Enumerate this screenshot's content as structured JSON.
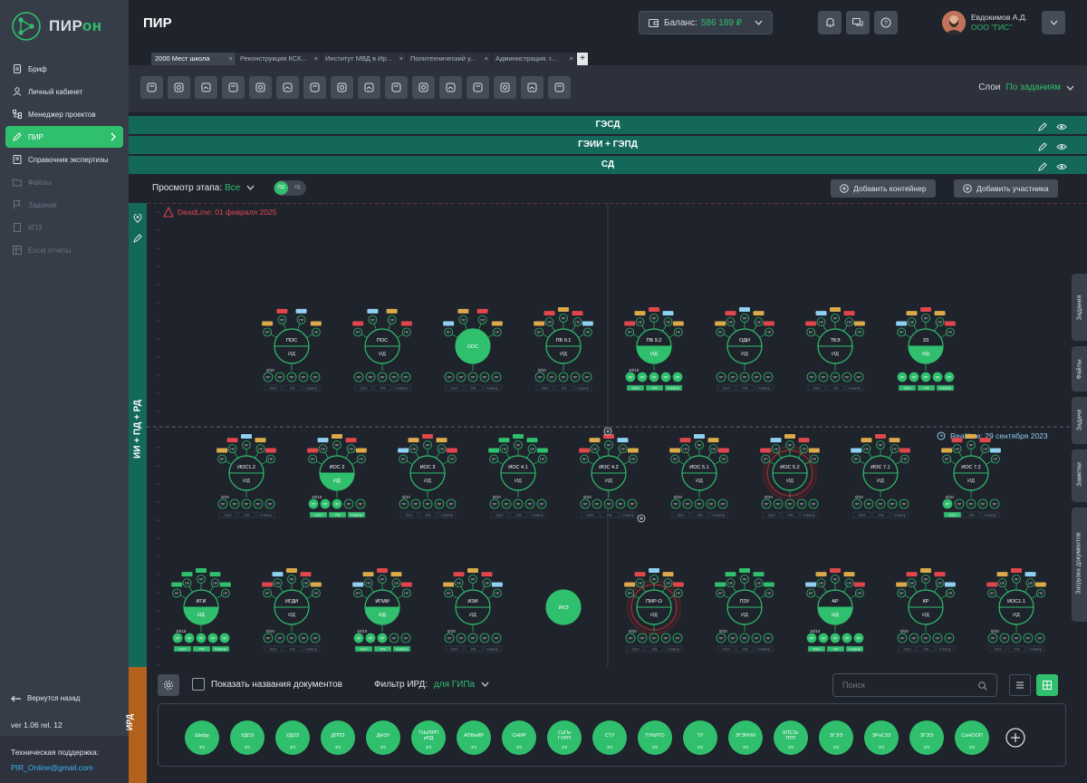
{
  "brand": {
    "name_prefix": "ПИР",
    "name_suffix": "он"
  },
  "sidebar": {
    "items": [
      {
        "label": "Бриф",
        "state": "normal"
      },
      {
        "label": "Личный кабинет",
        "state": "normal"
      },
      {
        "label": "Менеджер проектов",
        "state": "normal"
      },
      {
        "label": "ПИР",
        "state": "active"
      },
      {
        "label": "Справочник экспертизы",
        "state": "normal"
      },
      {
        "label": "Файлы",
        "state": "disabled"
      },
      {
        "label": "Задания",
        "state": "disabled"
      },
      {
        "label": "КПЗ",
        "state": "disabled"
      },
      {
        "label": "Excel отчеты",
        "state": "disabled"
      }
    ],
    "back_label": "Вернутся назад",
    "version": "ver 1.06 rel. 12",
    "support_title": "Техническая поддержка:",
    "support_email": "PIR_Online@gmail.com"
  },
  "header": {
    "title": "ПИР",
    "balance_label": "Баланс:",
    "balance_value": "586 189 ₽",
    "user_name": "Евдокимов А.Д.",
    "user_org": "ООО \"ГИС\""
  },
  "tabs": [
    {
      "label": "2000 Мест школа",
      "active": true
    },
    {
      "label": "Реконструкция КСК...",
      "active": false
    },
    {
      "label": "Институт МВД в Ир...",
      "active": false
    },
    {
      "label": "Политехнический у...",
      "active": false
    },
    {
      "label": "Администрация. г...",
      "active": false
    }
  ],
  "toolbar": {
    "layers_label": "Слои",
    "layers_value": "По заданиям",
    "tool_icons": [
      "doc-icon",
      "circle-icon",
      "users-icon",
      "refresh-icon",
      "search-icon",
      "chart-icon",
      "ruble-icon",
      "layers-icon",
      "zoom-icon",
      "link-icon",
      "warning-icon",
      "phone-icon",
      "percent-icon",
      "copy-icon",
      "list-icon",
      "image-icon"
    ]
  },
  "stages": [
    "ГЭСД",
    "ГЭИИ + ГЭПД",
    "СД"
  ],
  "filter": {
    "label": "Просмотр этапа:",
    "value": "Все",
    "toggle_on": "ПД",
    "toggle_off": "РД",
    "add_container": "Добавить контейнер",
    "add_participant": "Добавить участника"
  },
  "stripe_label": "ИИ + ПД + РД",
  "canvas": {
    "deadline": "DeadLine: 01 февраля 2025",
    "realtime": "Realtime: 29 сентября 2023"
  },
  "rows": [
    {
      "items": [
        {
          "name": "ПОС",
          "fill": 0.0,
          "count": "0/10",
          "pr": 4,
          "green": 0
        },
        {
          "name": "ПОС",
          "fill": 0.0,
          "count": "",
          "pr": 4,
          "green": 0
        },
        {
          "name": "ООС",
          "fill": 1.0,
          "count": "",
          "pr": 4,
          "green": 0
        },
        {
          "name": "ПБ 9.1",
          "fill": 0.0,
          "count": "0/10",
          "pr": 5,
          "green": 0
        },
        {
          "name": "ПБ 9.2",
          "fill": 0.5,
          "count": "10/10",
          "pr": 5,
          "green": 5
        },
        {
          "name": "ОДИ",
          "fill": 0.0,
          "count": "",
          "pr": 5,
          "green": 0
        },
        {
          "name": "ТБЭ",
          "fill": 0.0,
          "count": "",
          "pr": 5,
          "green": 0
        },
        {
          "name": "ЗЗ",
          "fill": 0.5,
          "count": "",
          "pr": 5,
          "green": 5
        }
      ]
    },
    {
      "items": [
        {
          "name": "ИОС1.2",
          "fill": 0.0,
          "count": "0/10",
          "pr": 5,
          "green": 0
        },
        {
          "name": "ИОС 2",
          "fill": 0.5,
          "count": "10/10",
          "pr": 5,
          "green": 3
        },
        {
          "name": "ИОС 3",
          "fill": 0.0,
          "count": "0/10",
          "pr": 5,
          "green": 0
        },
        {
          "name": "ИОС 4.1",
          "fill": 0.0,
          "count": "0/10",
          "pr": 5,
          "green": 0
        },
        {
          "name": "ИОС 4.2",
          "fill": 0.0,
          "count": "0/10",
          "pr": 5,
          "green": 0
        },
        {
          "name": "ИОС 5.1",
          "fill": 0.0,
          "count": "0/10",
          "pr": 5,
          "green": 0
        },
        {
          "name": "ИОС 5.2",
          "fill": 0.0,
          "count": "0/10",
          "pr": 5,
          "green": 0
        },
        {
          "name": "ИОС 7.1",
          "fill": 0.0,
          "count": "0/10",
          "pr": 5,
          "green": 0
        },
        {
          "name": "ИОС 7.2",
          "fill": 0.0,
          "count": "6/10",
          "pr": 5,
          "green": 1
        }
      ]
    },
    {
      "items": [
        {
          "name": "ИГИ",
          "fill": 0.5,
          "count": "10/10",
          "pr": 5,
          "green": 5
        },
        {
          "name": "ИГДИ",
          "fill": 0.0,
          "count": "0/10",
          "pr": 5,
          "green": 0
        },
        {
          "name": "ИГМИ",
          "fill": 0.5,
          "count": "10/10",
          "pr": 5,
          "green": 3
        },
        {
          "name": "ИЗИ",
          "fill": 0.0,
          "count": "0/10",
          "pr": 5,
          "green": 0
        },
        {
          "name": "ИКЭ",
          "fill": 1.0,
          "count": "",
          "pr": 0,
          "green": 0
        },
        {
          "name": "ПИР-О",
          "fill": 0.0,
          "count": "0/10",
          "pr": 5,
          "green": 0
        },
        {
          "name": "ПЗУ",
          "fill": 0.0,
          "count": "0/10",
          "pr": 5,
          "green": 0
        },
        {
          "name": "АР",
          "fill": 0.5,
          "count": "10/10",
          "pr": 5,
          "green": 5
        },
        {
          "name": "КР",
          "fill": 0.0,
          "count": "0/10",
          "pr": 5,
          "green": 0
        },
        {
          "name": "ИОС1.1",
          "fill": 0.0,
          "count": "0/10",
          "pr": 5,
          "green": 0
        }
      ]
    }
  ],
  "node_labels": {
    "id": "ИД",
    "pr": "ПР",
    "sogl": "Согл",
    "utv": "Утв",
    "nkontr": "Н.контр"
  },
  "ird": {
    "stripe_label": "ИРД",
    "show_names_label": "Показать названия документов",
    "filter_label": "Фильтр ИРД:",
    "filter_value": "для ГИПа",
    "search_placeholder": "Поиск",
    "docs": [
      {
        "name": "Шифр",
        "count": "3/3"
      },
      {
        "name": "УДОЗ",
        "count": "3/3"
      },
      {
        "name": "УДОЗ",
        "count": "3/3"
      },
      {
        "name": "ДППЗ",
        "count": "3/3"
      },
      {
        "name": "ДНЗУ",
        "count": "3/3"
      },
      {
        "name": "ТНнПРП иПД",
        "count": "3/3"
      },
      {
        "name": "АПВиИР",
        "count": "3/3"
      },
      {
        "name": "СНИР",
        "count": "3/3"
      },
      {
        "name": "СоПн ГУРП",
        "count": "3/3"
      },
      {
        "name": "СТУ",
        "count": "3/3"
      },
      {
        "name": "ТУКИТО",
        "count": "3/3"
      },
      {
        "name": "ТУ",
        "count": "3/3"
      },
      {
        "name": "ЗГЭРИИ",
        "count": "3/3"
      },
      {
        "name": "КПСЗо ППТ",
        "count": "3/3"
      },
      {
        "name": "ЗГЭЭ",
        "count": "3/3"
      },
      {
        "name": "ЗРнСЗЗ",
        "count": "3/3"
      },
      {
        "name": "ЗГЭЭ",
        "count": "3/3"
      },
      {
        "name": "СоНООП",
        "count": "3/3"
      }
    ]
  },
  "right_tabs": [
    "Задания",
    "Файлы",
    "Задачи",
    "Заметки",
    "Загрузка документов"
  ],
  "colors": {
    "green": "#2fbf6d",
    "teal": "#13685a",
    "red": "#e0474c",
    "yellow": "#d9a94a",
    "blue": "#8fd0f0",
    "bg": "#1f232c"
  }
}
